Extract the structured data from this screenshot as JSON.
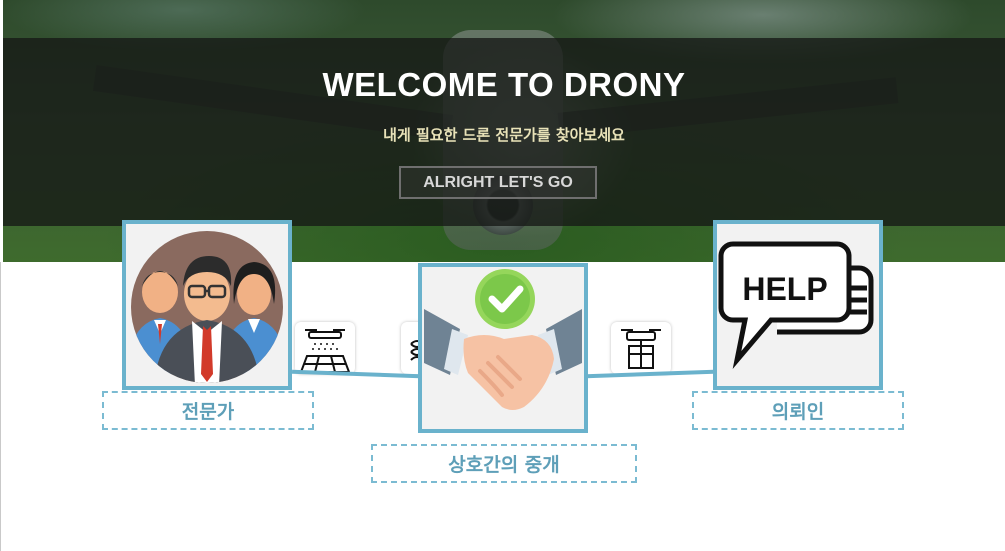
{
  "hero": {
    "title": "WELCOME TO DRONY",
    "subtitle": "내게 필요한 드론 전문가를 찾아보세요",
    "cta_label": "ALRIGHT LET'S GO"
  },
  "cards": {
    "experts": {
      "label": "전문가",
      "icon": "expert-group-icon"
    },
    "mediation": {
      "label": "상호간의 중개",
      "icon": "handshake-check-icon"
    },
    "client": {
      "label": "의뢰인",
      "icon": "help-speech-bubble-icon"
    }
  },
  "help_text": "HELP",
  "colors": {
    "accent": "#6ab2cc",
    "label_text": "#5e9fb8",
    "check_green": "#7cc84a"
  }
}
